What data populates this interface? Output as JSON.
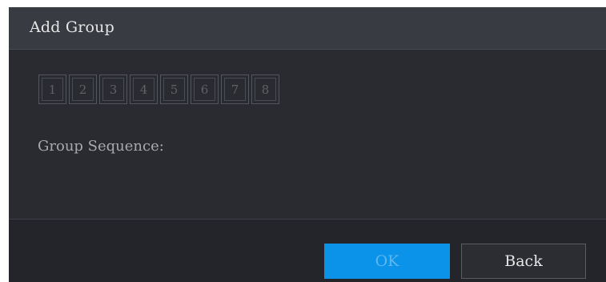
{
  "dialog": {
    "title": "Add Group",
    "channels": [
      "1",
      "2",
      "3",
      "4",
      "5",
      "6",
      "7",
      "8"
    ],
    "group_sequence_label": "Group Sequence:",
    "ok_label": "OK",
    "back_label": "Back"
  },
  "colors": {
    "primary_button": "#0b93ea",
    "dialog_background": "#2a2b31",
    "title_bar": "#393b42"
  }
}
